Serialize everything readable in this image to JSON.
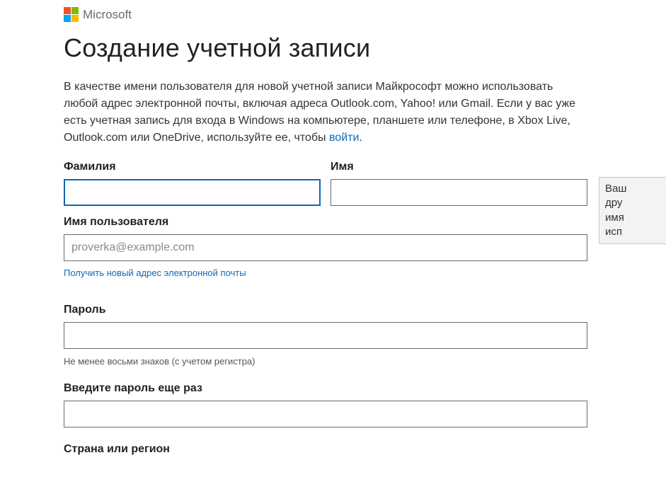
{
  "header": {
    "brand": "Microsoft"
  },
  "title": "Создание учетной записи",
  "intro": {
    "text_before_link": "В качестве имени пользователя для новой учетной записи Майкрософт можно использовать любой адрес электронной почты, включая адреса Outlook.com, Yahoo! или Gmail. Если у вас уже есть учетная запись для входа в Windows на компьютере, планшете или телефоне, в Xbox Live, Outlook.com или OneDrive, используйте ее, чтобы ",
    "link_text": "войти",
    "text_after_link": "."
  },
  "form": {
    "lastname": {
      "label": "Фамилия",
      "value": ""
    },
    "firstname": {
      "label": "Имя",
      "value": ""
    },
    "username": {
      "label": "Имя пользователя",
      "placeholder": "proverka@example.com",
      "value": ""
    },
    "get_email_link": "Получить новый адрес электронной почты",
    "password": {
      "label": "Пароль",
      "value": "",
      "hint": "Не менее восьми знаков (с учетом регистра)"
    },
    "password_confirm": {
      "label": "Введите пароль еще раз",
      "value": ""
    },
    "country": {
      "label": "Страна или регион"
    }
  },
  "tooltip": {
    "line1": "Ваш",
    "line2": "дру",
    "line3": "имя",
    "line4": "исп"
  }
}
